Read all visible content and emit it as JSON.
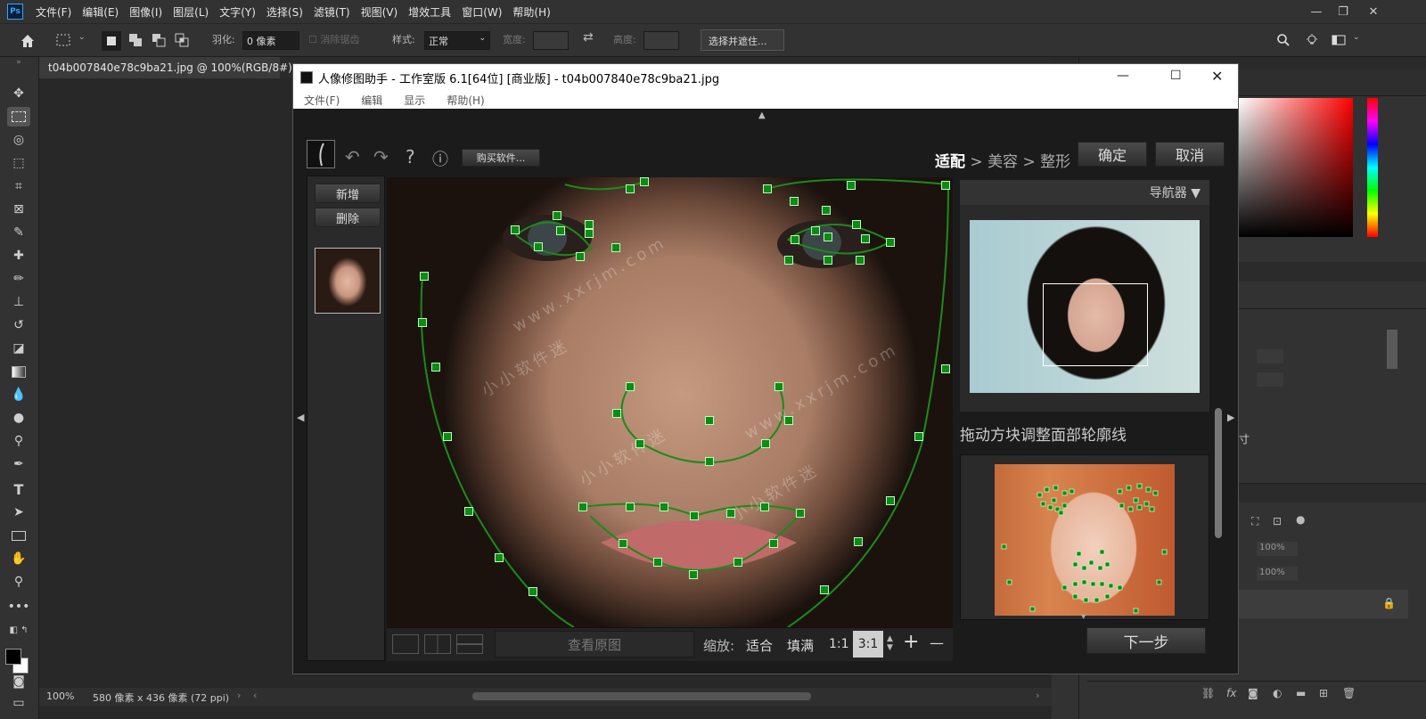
{
  "ps": {
    "menu": [
      "文件(F)",
      "编辑(E)",
      "图像(I)",
      "图层(L)",
      "文字(Y)",
      "选择(S)",
      "滤镜(T)",
      "视图(V)",
      "增效工具",
      "窗口(W)",
      "帮助(H)"
    ],
    "options": {
      "feather_label": "羽化:",
      "feather_value": "0 像素",
      "antialias": "消除锯齿",
      "style_label": "样式:",
      "style_value": "正常",
      "width_label": "宽度:",
      "height_label": "高度:",
      "select_mask": "选择并遮住..."
    },
    "doc_tab": "t04b007840e78c9ba21.jpg @ 100%(RGB/8#)",
    "status": {
      "zoom": "100%",
      "info": "580 像素 x 436 像素 (72 ppi)"
    },
    "panels": {
      "opacity": "100%",
      "fill": "100%",
      "size_char": "寸"
    }
  },
  "plugin": {
    "title": "人像修图助手 - 工作室版 6.1[64位] [商业版] - t04b007840e78c9ba21.jpg",
    "menu": [
      "文件(F)",
      "编辑",
      "显示",
      "帮助(H)"
    ],
    "buy": "购买软件...",
    "steps": {
      "s1": "适配",
      "s2": "美容",
      "s3": "整形",
      "sep": ">"
    },
    "ok": "确定",
    "cancel": "取消",
    "add": "新增",
    "delete": "删除",
    "navigator": "导航器",
    "instruction": "拖动方块调整面部轮廓线",
    "view_original": "查看原图",
    "zoom": {
      "label": "缩放:",
      "fit": "适合",
      "fill": "填满",
      "r1": "1:1",
      "r3": "3:1",
      "plus": "+",
      "minus": "—"
    },
    "next": "下一步",
    "watermark1": "www.xxrjm.com",
    "watermark2": "小小软件迷",
    "watermark3": "www.xxrjm.com"
  }
}
